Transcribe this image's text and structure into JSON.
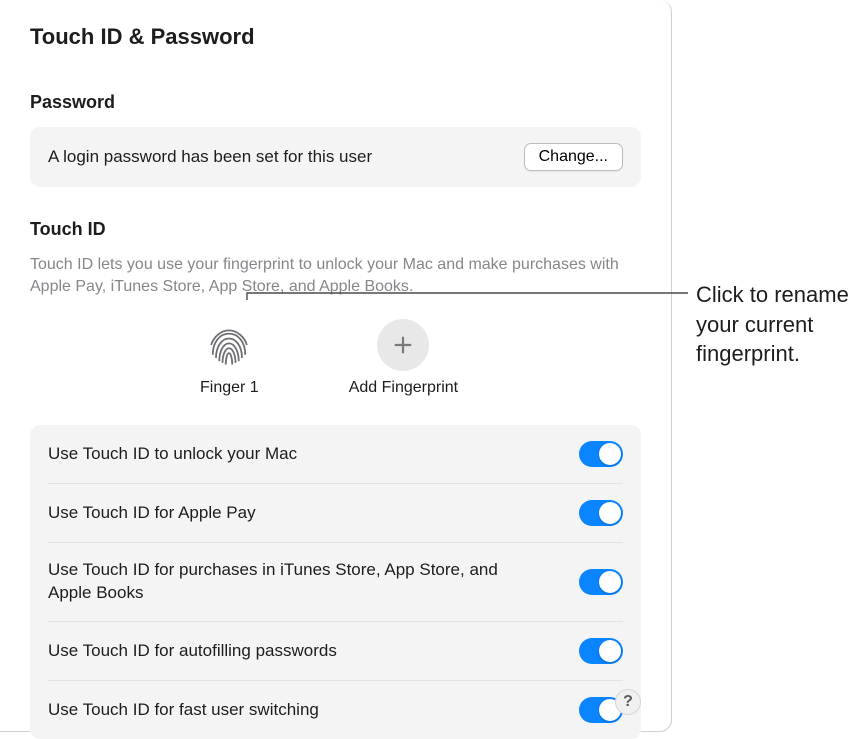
{
  "title": "Touch ID & Password",
  "password": {
    "heading": "Password",
    "status": "A login password has been set for this user",
    "changeLabel": "Change..."
  },
  "touchid": {
    "heading": "Touch ID",
    "description": "Touch ID lets you use your fingerprint to unlock your Mac and make purchases with Apple Pay, iTunes Store, App Store, and Apple Books.",
    "finger1": "Finger 1",
    "addLabel": "Add Fingerprint"
  },
  "options": [
    {
      "label": "Use Touch ID to unlock your Mac",
      "on": true
    },
    {
      "label": "Use Touch ID for Apple Pay",
      "on": true
    },
    {
      "label": "Use Touch ID for purchases in iTunes Store, App Store, and Apple Books",
      "on": true
    },
    {
      "label": "Use Touch ID for autofilling passwords",
      "on": true
    },
    {
      "label": "Use Touch ID for fast user switching",
      "on": true
    }
  ],
  "help": "?",
  "callout": "Click to rename your current fingerprint."
}
